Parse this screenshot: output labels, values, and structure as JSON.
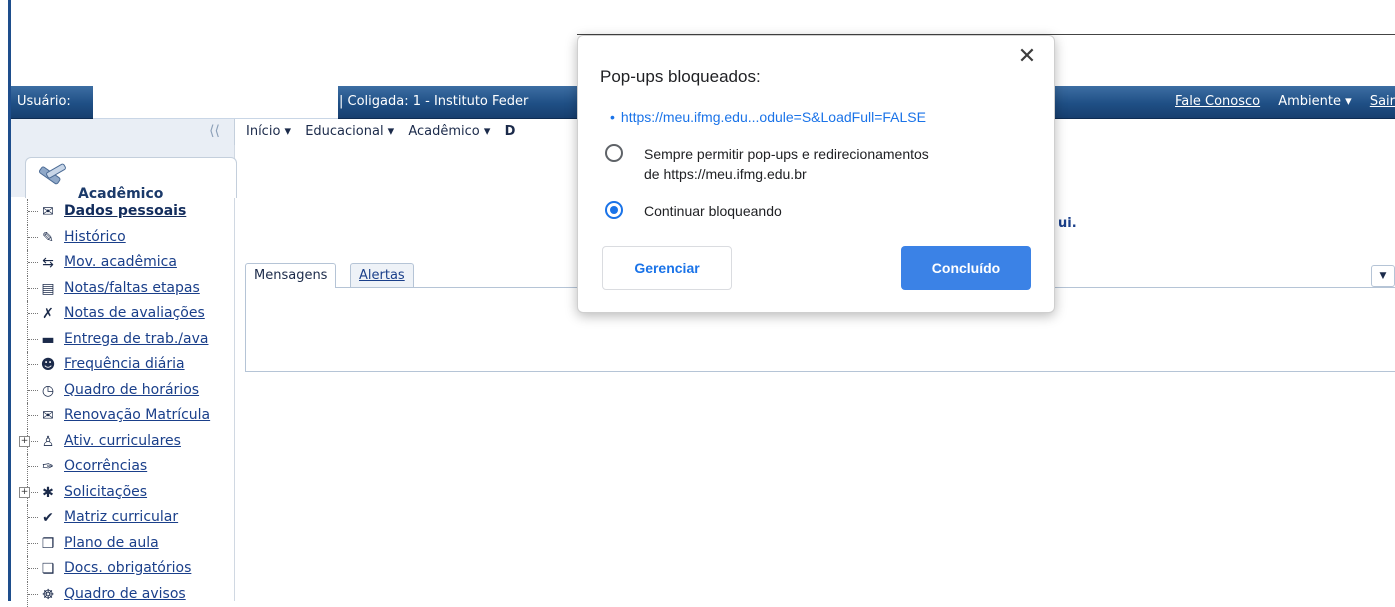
{
  "header": {
    "user_label": "Usuário:",
    "coligada": "| Coligada: 1 - Instituto Feder",
    "links": [
      "Fale Conosco",
      "Ambiente ▾",
      "Sair"
    ]
  },
  "breadcrumb": {
    "collapse": "⟨⟨",
    "items": [
      "Início ▾",
      "Educacional ▾",
      "Acadêmico ▾",
      "D"
    ]
  },
  "sidebar": {
    "title": "Acadêmico",
    "items": [
      {
        "label": "Dados pessoais",
        "icon": "id-card-icon",
        "glyph": "✉",
        "bold": true,
        "expandable": false
      },
      {
        "label": "Histórico",
        "icon": "pencil-icon",
        "glyph": "✎",
        "bold": false,
        "expandable": false
      },
      {
        "label": "Mov. acadêmica",
        "icon": "transfer-arrows-icon",
        "glyph": "⇆",
        "bold": false,
        "expandable": false
      },
      {
        "label": "Notas/faltas etapas",
        "icon": "table-icon",
        "glyph": "▤",
        "bold": false,
        "expandable": false
      },
      {
        "label": "Notas de avaliações",
        "icon": "grades-icon",
        "glyph": "✗",
        "bold": false,
        "expandable": false
      },
      {
        "label": "Entrega de trab./ava",
        "icon": "tray-icon",
        "glyph": "▬",
        "bold": false,
        "expandable": false
      },
      {
        "label": "Frequência diária",
        "icon": "people-icon",
        "glyph": "☻",
        "bold": false,
        "expandable": false
      },
      {
        "label": "Quadro de horários",
        "icon": "clock-icon",
        "glyph": "◷",
        "bold": false,
        "expandable": false
      },
      {
        "label": "Renovação Matrícula",
        "icon": "renewal-icon",
        "glyph": "✉",
        "bold": false,
        "expandable": false
      },
      {
        "label": "Ativ. curriculares",
        "icon": "activity-icon",
        "glyph": "♙",
        "bold": false,
        "expandable": true
      },
      {
        "label": "Ocorrências",
        "icon": "quill-icon",
        "glyph": "✑",
        "bold": false,
        "expandable": false
      },
      {
        "label": "Solicitações",
        "icon": "request-icon",
        "glyph": "✱",
        "bold": false,
        "expandable": true
      },
      {
        "label": "Matriz curricular",
        "icon": "check-icon",
        "glyph": "✔",
        "bold": false,
        "expandable": false
      },
      {
        "label": "Plano de aula",
        "icon": "book-icon",
        "glyph": "❐",
        "bold": false,
        "expandable": false
      },
      {
        "label": "Docs. obrigatórios",
        "icon": "documents-icon",
        "glyph": "❏",
        "bold": false,
        "expandable": false
      },
      {
        "label": "Quadro de avisos",
        "icon": "notice-board-icon",
        "glyph": "☸",
        "bold": false,
        "expandable": false
      }
    ]
  },
  "main": {
    "tabs": [
      {
        "label": "Mensagens",
        "active": true
      },
      {
        "label": "Alertas",
        "active": false
      }
    ],
    "background_text": "ui."
  },
  "popup": {
    "title": "Pop-ups bloqueados:",
    "close": "✕",
    "url": "https://meu.ifmg.edu...odule=S&LoadFull=FALSE",
    "option_allow_line1": "Sempre permitir pop-ups e redirecionamentos",
    "option_allow_line2": "de https://meu.ifmg.edu.br",
    "option_block": "Continuar bloqueando",
    "selected": "block",
    "manage_label": "Gerenciar",
    "done_label": "Concluído"
  },
  "colors": {
    "header": "#1f4f85",
    "accent": "#1a73e8"
  }
}
